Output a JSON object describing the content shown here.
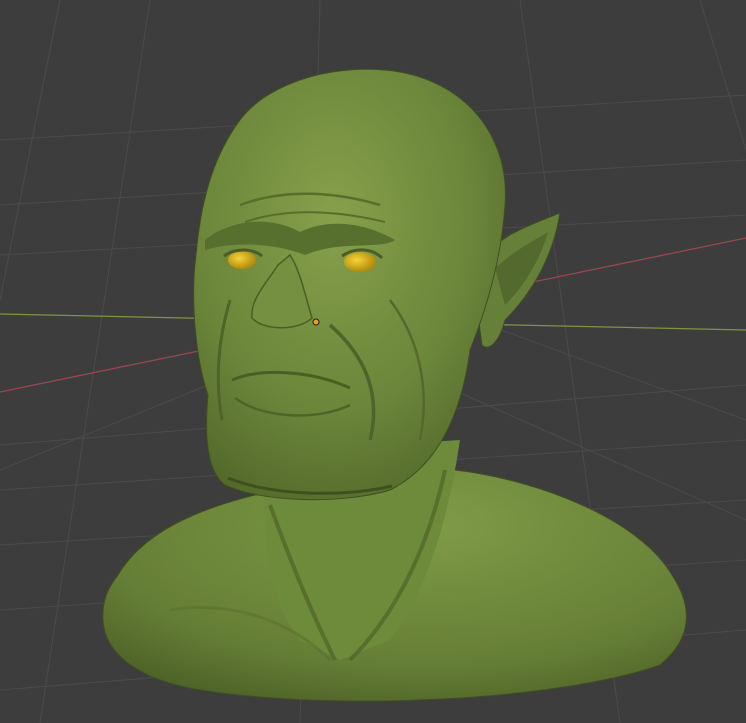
{
  "app": {
    "name": "3D Viewport"
  },
  "viewport": {
    "background": "#3d3d3d",
    "grid_color": "#4a4a4a",
    "x_axis_color": "#9a4650",
    "y_axis_color": "#7e9443",
    "object_origin_color": "#f0a020",
    "mesh": {
      "subject": "orc-bust-sculpt",
      "base_color": "#6f8a3e",
      "eye_color": "#d7b012"
    }
  }
}
